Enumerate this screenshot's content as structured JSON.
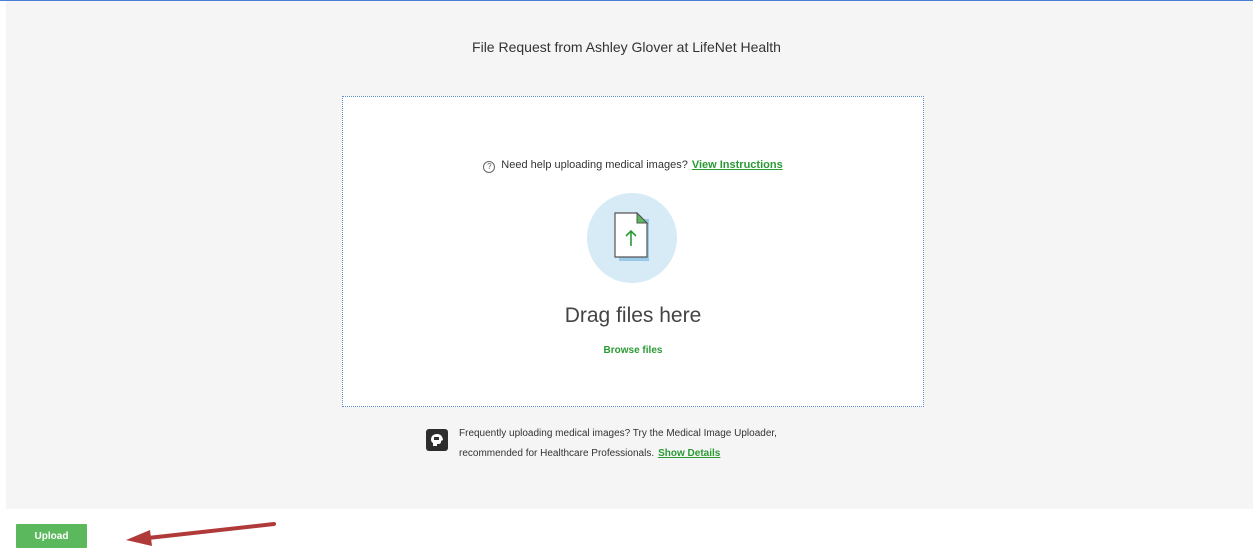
{
  "header": {
    "title": "File Request from Ashley Glover at LifeNet Health"
  },
  "dropzone": {
    "help_text": "Need help uploading medical images?",
    "help_link": "View Instructions",
    "drag_title": "Drag files here",
    "browse_label": "Browse files",
    "icon": "file-upload-icon"
  },
  "promo": {
    "line1": "Frequently uploading medical images? Try the Medical Image Uploader,",
    "line2": "recommended for Healthcare Professionals.",
    "link": "Show Details",
    "icon": "medical-uploader-icon"
  },
  "footer": {
    "upload_label": "Upload"
  },
  "colors": {
    "accent_green": "#2a9a34",
    "button_green": "#5cb85c",
    "panel_bg": "#f5f5f5",
    "circle_bg": "#d6ebf6",
    "annotation_arrow": "#b03a3a"
  }
}
